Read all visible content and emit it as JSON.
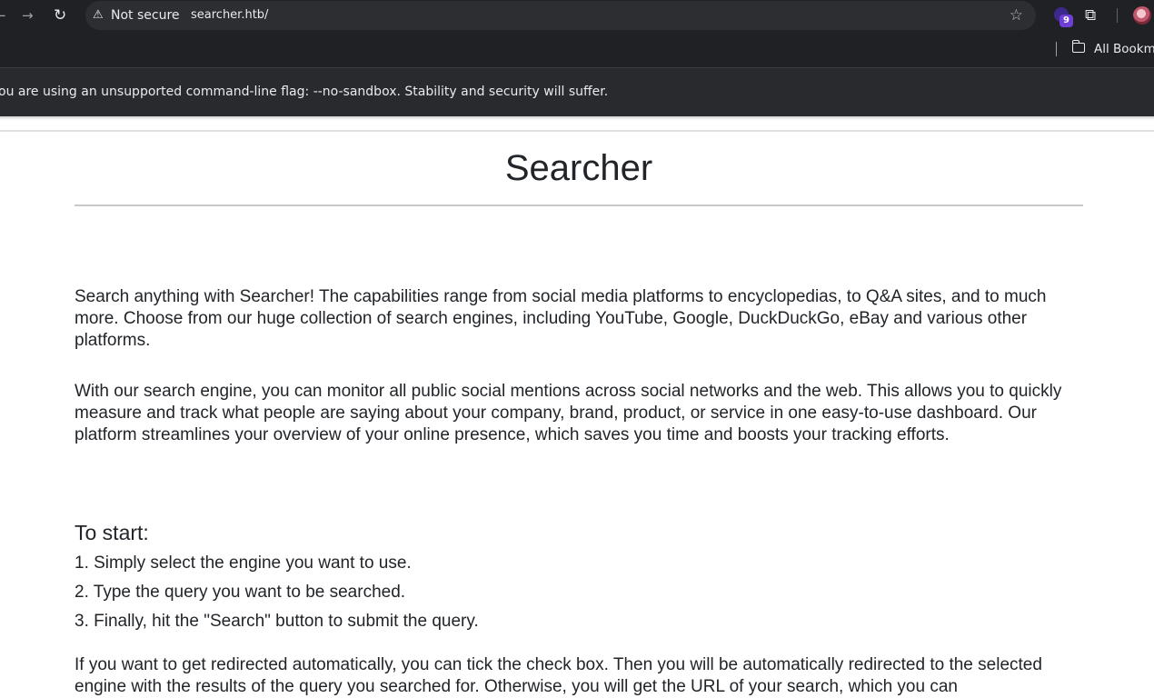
{
  "browser": {
    "nav": {
      "back_icon": "arrow-left-icon",
      "forward_icon": "arrow-right-icon",
      "reload_icon": "reload-icon"
    },
    "address_bar": {
      "security_icon": "warning-triangle-icon",
      "security_status": "Not secure",
      "url": "searcher.htb/"
    },
    "extensions": {
      "badge_count": "9"
    },
    "bookmarks_bar": {
      "folder_label": "All Bookm"
    },
    "infobar": {
      "message": "ou are using an unsupported command-line flag: --no-sandbox. Stability and security will suffer."
    }
  },
  "page": {
    "title": "Searcher",
    "intro_paragraphs": [
      "Search anything with Searcher! The capabilities range from social media platforms to encyclopedias, to Q&A sites, and to much more. Choose from our huge collection of search engines, including YouTube, Google, DuckDuckGo, eBay and various other platforms.",
      "With our search engine, you can monitor all public social mentions across social networks and the web. This allows you to quickly measure and track what people are saying about your company, brand, product, or service in one easy-to-use dashboard. Our platform streamlines your overview of your online presence, which saves you time and boosts your tracking efforts."
    ],
    "start_heading": "To start:",
    "steps": [
      "1. Simply select the engine you want to use.",
      "2. Type the query you want to be searched.",
      "3. Finally, hit the \"Search\" button to submit the query."
    ],
    "redirect_paragraph": "If you want to get redirected automatically, you can tick the check box. Then you will be automatically redirected to the selected engine with the results of the query you searched for. Otherwise, you will get the URL of your search, which you can"
  }
}
